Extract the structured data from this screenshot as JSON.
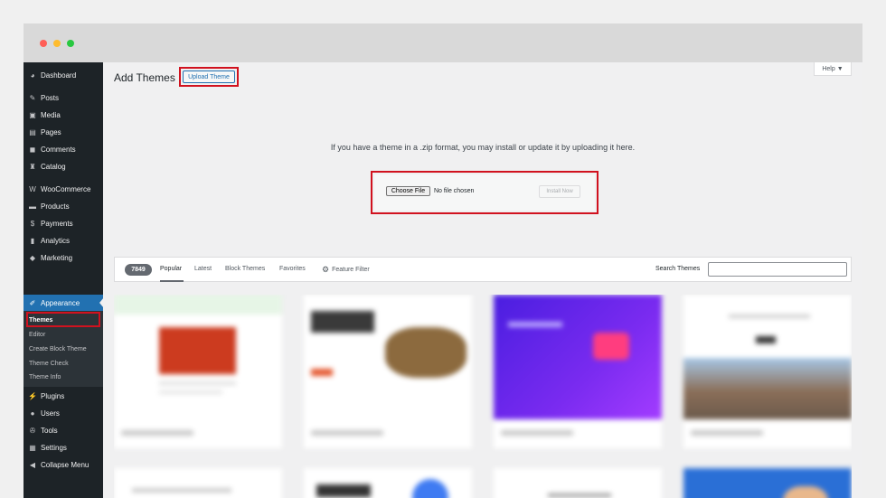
{
  "sidebar": {
    "items": [
      {
        "label": "Dashboard",
        "icon": "dashboard-icon",
        "glyph": "◕"
      },
      {
        "label": "Posts",
        "icon": "pin-icon",
        "glyph": "✎"
      },
      {
        "label": "Media",
        "icon": "media-icon",
        "glyph": "▣"
      },
      {
        "label": "Pages",
        "icon": "pages-icon",
        "glyph": "▤"
      },
      {
        "label": "Comments",
        "icon": "comment-icon",
        "glyph": "◼"
      },
      {
        "label": "Catalog",
        "icon": "catalog-icon",
        "glyph": "♜"
      },
      {
        "label": "WooCommerce",
        "icon": "woocommerce-icon",
        "glyph": "W"
      },
      {
        "label": "Products",
        "icon": "products-icon",
        "glyph": "▬"
      },
      {
        "label": "Payments",
        "icon": "payments-icon",
        "glyph": "$"
      },
      {
        "label": "Analytics",
        "icon": "analytics-icon",
        "glyph": "▮"
      },
      {
        "label": "Marketing",
        "icon": "marketing-icon",
        "glyph": "◆"
      },
      {
        "label": "Appearance",
        "icon": "brush-icon",
        "glyph": "✐"
      },
      {
        "label": "Plugins",
        "icon": "plugin-icon",
        "glyph": "⚡"
      },
      {
        "label": "Users",
        "icon": "users-icon",
        "glyph": "●"
      },
      {
        "label": "Tools",
        "icon": "wrench-icon",
        "glyph": "✇"
      },
      {
        "label": "Settings",
        "icon": "settings-icon",
        "glyph": "▦"
      },
      {
        "label": "Collapse Menu",
        "icon": "collapse-icon",
        "glyph": "◀"
      }
    ],
    "submenu": [
      "Themes",
      "Editor",
      "Create Block Theme",
      "Theme Check",
      "Theme Info"
    ]
  },
  "header": {
    "title": "Add Themes",
    "upload_label": "Upload Theme",
    "help_label": "Help ▼"
  },
  "upload": {
    "info": "If you have a theme in a .zip format, you may install or update it by uploading it here.",
    "choose_label": "Choose File",
    "no_file": "No file chosen",
    "install_label": "Install Now"
  },
  "filter": {
    "count": "7849",
    "tabs": [
      "Popular",
      "Latest",
      "Block Themes",
      "Favorites"
    ],
    "feature_filter": "Feature Filter",
    "search_label": "Search Themes",
    "search_value": ""
  },
  "colors": {
    "sidebar_bg": "#1d2327",
    "accent": "#2271b1",
    "highlight": "#d1121f"
  }
}
